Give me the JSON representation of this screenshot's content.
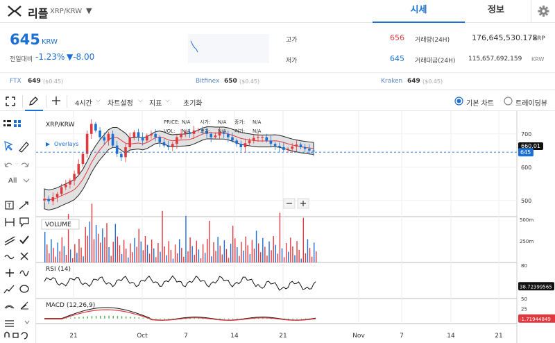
{
  "header": {
    "coin_name": "리플",
    "pair": "XRP/KRW",
    "tabs": [
      {
        "label": "시세",
        "active": true
      },
      {
        "label": "정보",
        "active": false
      }
    ]
  },
  "summary": {
    "price": "645",
    "unit": "KRW",
    "change_label": "전일대비",
    "change_pct": "-1.23%",
    "change_abs": "▼-8.00",
    "high_label": "고가",
    "high": "656",
    "low_label": "저가",
    "low": "645",
    "volume_label": "거래량(24H)",
    "volume": "176,645,530.178",
    "volume_unit": "XRP",
    "amount_label": "거래대금(24H)",
    "amount": "115,657,692,159",
    "amount_unit": "KRW"
  },
  "exchanges": [
    {
      "name": "FTX",
      "price": "649",
      "chg": "($0.45)"
    },
    {
      "name": "Bitfinex",
      "price": "650",
      "chg": "($0.45)"
    },
    {
      "name": "Kraken",
      "price": "649",
      "chg": "($0.45)"
    }
  ],
  "toolbar": {
    "interval": "4시간",
    "chart_settings": "차트설정",
    "indicators": "지표",
    "reset": "초기화",
    "basic_chart": "기본 차트",
    "tradingview": "트레이딩뷰"
  },
  "tools": {
    "zoom_select": "All"
  },
  "colors": {
    "accent": "#1c6fd3",
    "up": "#e0383e",
    "down": "#1c6fd3"
  },
  "chart_data": [
    {
      "type": "candlestick",
      "title": "XRP/KRW",
      "overlays_label": "Overlays",
      "legend": {
        "price_label": "PRICE:",
        "vol_label": "VOL:",
        "open_label": "시가:",
        "close_label": "종가:",
        "high_label": "고가:",
        "low_label": "저가:",
        "na": "N/A"
      },
      "ylim": [
        460,
        760
      ],
      "yticks": [
        500,
        600,
        700
      ],
      "current_price": 645,
      "current_tag": "645",
      "aux_tag": "660.01",
      "x_ticks": [
        "21",
        "Oct",
        "7",
        "14",
        "21",
        "Nov",
        "7",
        "14",
        "21"
      ],
      "close": [
        505,
        498,
        510,
        520,
        540,
        548,
        560,
        580,
        610,
        640,
        700,
        730,
        710,
        690,
        680,
        700,
        665,
        640,
        630,
        660,
        690,
        705,
        690,
        680,
        695,
        700,
        690,
        675,
        665,
        660,
        670,
        690,
        700,
        705,
        700,
        710,
        712,
        708,
        700,
        690,
        695,
        705,
        700,
        690,
        680,
        670,
        660,
        672,
        680,
        688,
        690,
        690,
        680,
        670,
        664,
        660,
        652,
        655,
        662,
        668,
        660,
        655,
        650,
        648
      ]
    },
    {
      "type": "bar",
      "title": "VOLUME",
      "ylim": [
        0,
        500
      ],
      "yticks": [
        "250m",
        "500m"
      ]
    },
    {
      "type": "line",
      "title": "RSI (14)",
      "ylim": [
        20,
        80
      ],
      "yticks": [
        80
      ],
      "last_value": "38.72399565"
    },
    {
      "type": "line",
      "title": "MACD (12,26,9)",
      "ylim": [
        -10,
        40
      ],
      "yticks": [
        50,
        25,
        0
      ],
      "last_value": "-1.71944849"
    }
  ]
}
